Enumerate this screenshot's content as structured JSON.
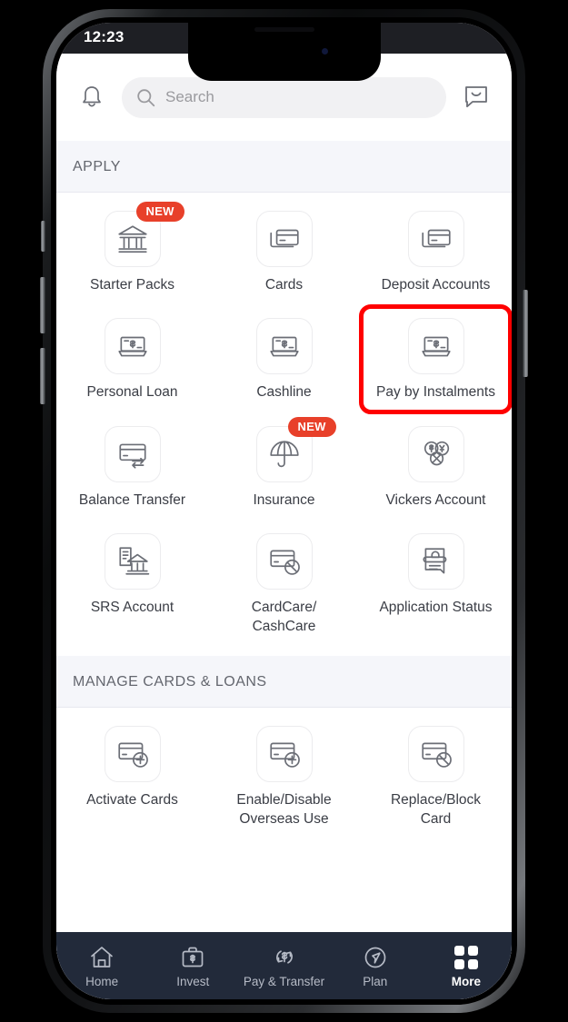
{
  "status_bar": {
    "time": "12:23"
  },
  "header": {
    "bell_icon": "bell-icon",
    "chat_icon": "chat-icon",
    "search": {
      "placeholder": "Search",
      "value": "",
      "icon": "search-icon"
    }
  },
  "sections": [
    {
      "title": "APPLY",
      "tiles": [
        {
          "label": "Starter Packs",
          "icon": "bank-building-icon",
          "badge": "NEW",
          "highlighted": false
        },
        {
          "label": "Cards",
          "icon": "stacked-cards-icon",
          "badge": "",
          "highlighted": false
        },
        {
          "label": "Deposit Accounts",
          "icon": "stacked-cards-icon",
          "badge": "",
          "highlighted": false
        },
        {
          "label": "Personal Loan",
          "icon": "cash-tray-icon",
          "badge": "",
          "highlighted": false
        },
        {
          "label": "Cashline",
          "icon": "cash-tray-icon",
          "badge": "",
          "highlighted": false
        },
        {
          "label": "Pay by Instalments",
          "icon": "cash-tray-icon",
          "badge": "",
          "highlighted": true
        },
        {
          "label": "Balance Transfer",
          "icon": "card-transfer-icon",
          "badge": "",
          "highlighted": false
        },
        {
          "label": "Insurance",
          "icon": "umbrella-icon",
          "badge": "NEW",
          "highlighted": false
        },
        {
          "label": "Vickers Account",
          "icon": "currency-exchange-icon",
          "badge": "",
          "highlighted": false
        },
        {
          "label": "SRS Account",
          "icon": "document-bank-icon",
          "badge": "",
          "highlighted": false
        },
        {
          "label": "CardCare/\nCashCare",
          "icon": "card-blocked-icon",
          "badge": "",
          "highlighted": false
        },
        {
          "label": "Application Status",
          "icon": "document-status-icon",
          "badge": "",
          "highlighted": false
        }
      ]
    },
    {
      "title": "MANAGE CARDS & LOANS",
      "tiles": [
        {
          "label": "Activate Cards",
          "icon": "card-plus-icon",
          "badge": "",
          "highlighted": false
        },
        {
          "label": "Enable/Disable\nOverseas Use",
          "icon": "card-plus-icon",
          "badge": "",
          "highlighted": false
        },
        {
          "label": "Replace/Block\nCard",
          "icon": "card-blocked-icon",
          "badge": "",
          "highlighted": false
        }
      ]
    }
  ],
  "bottom_nav": {
    "items": [
      {
        "label": "Home",
        "icon": "home-icon",
        "active": false
      },
      {
        "label": "Invest",
        "icon": "briefcase-icon",
        "active": false
      },
      {
        "label": "Pay & Transfer",
        "icon": "transfer-icon",
        "active": false
      },
      {
        "label": "Plan",
        "icon": "compass-icon",
        "active": false
      },
      {
        "label": "More",
        "icon": "grid-icon",
        "active": true
      }
    ]
  },
  "colors": {
    "highlight_red": "#ff0000",
    "badge_red": "#e8402a",
    "nav_bar": "#222a3a",
    "section_bg": "#f5f6fa"
  }
}
